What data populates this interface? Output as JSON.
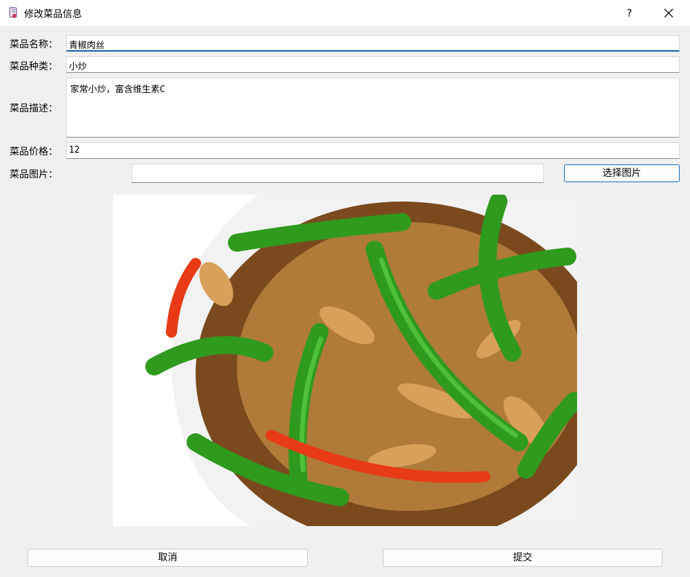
{
  "window": {
    "title": "修改菜品信息",
    "help_label": "?"
  },
  "form": {
    "name_label": "菜品名称：",
    "name_value": "青椒肉丝",
    "type_label": "菜品种类：",
    "type_value": "小炒",
    "desc_label": "菜品描述：",
    "desc_value": "家常小炒，富含维生素C",
    "price_label": "菜品价格：",
    "price_value": "12",
    "image_label": "菜品图片：",
    "image_path": "",
    "choose_image_label": "选择图片"
  },
  "actions": {
    "cancel_label": "取消",
    "submit_label": "提交"
  },
  "icons": {
    "app": "notebook-icon",
    "close": "close-icon"
  },
  "colors": {
    "accent": "#1160b0",
    "background": "#f0f0f0",
    "titlebar": "#ffffff"
  }
}
